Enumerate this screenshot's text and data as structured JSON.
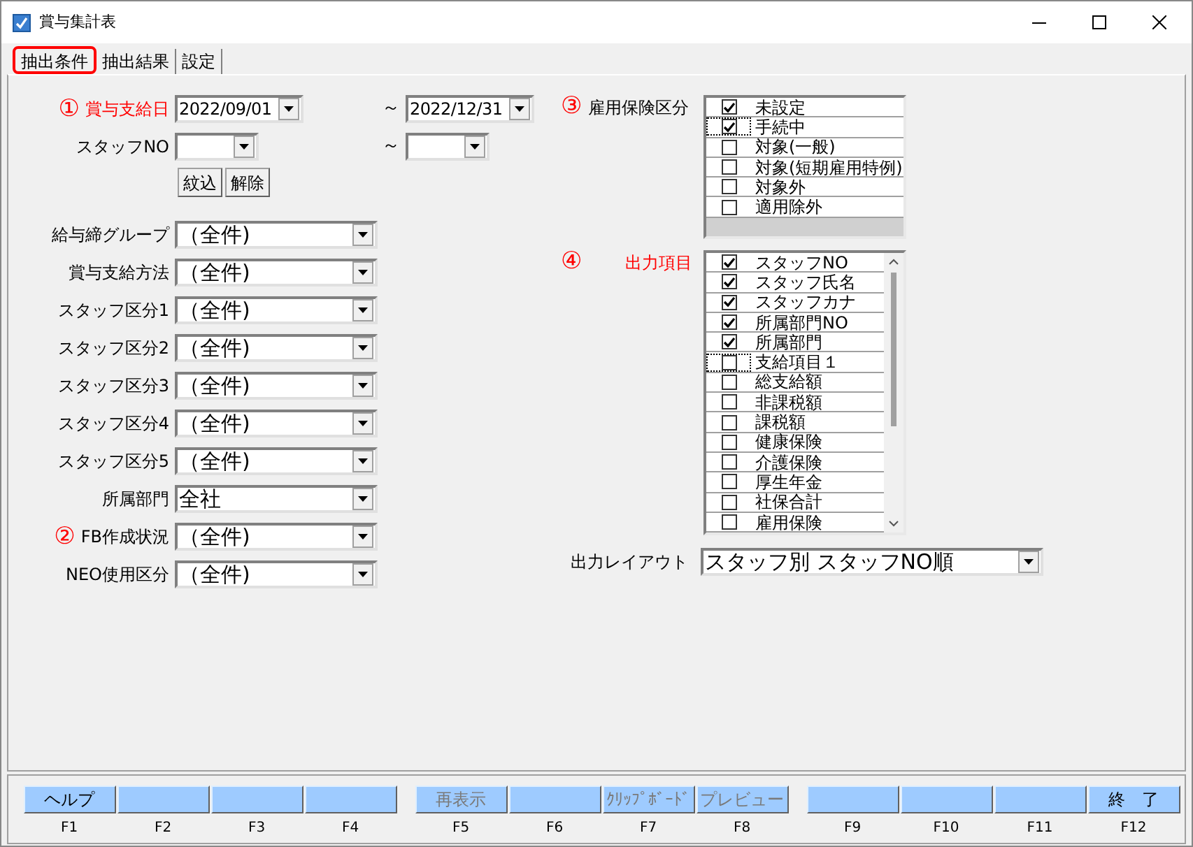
{
  "window": {
    "title": "賞与集計表"
  },
  "tabs": [
    {
      "label": "抽出条件",
      "selected": true,
      "annotated": true
    },
    {
      "label": "抽出結果",
      "selected": false,
      "annotated": false
    },
    {
      "label": "設定",
      "selected": false,
      "annotated": false
    }
  ],
  "range_fields": [
    {
      "kind": "date",
      "label": "賞与支給日",
      "marker": "①",
      "highlighted": true,
      "from": "2022/09/01",
      "separator": "～",
      "to": "2022/12/31"
    },
    {
      "kind": "code",
      "label": "スタッフNO",
      "highlighted": false,
      "separator": "～"
    }
  ],
  "filter_buttons": [
    "紋込",
    "解除"
  ],
  "select_fields": [
    {
      "label": "給与締グループ",
      "highlighted": false,
      "value": "（全件)"
    },
    {
      "label": "賞与支給方法",
      "highlighted": false,
      "value": "（全件)"
    },
    {
      "label": "スタッフ区分1",
      "highlighted": false,
      "value": "（全件)"
    },
    {
      "label": "スタッフ区分2",
      "highlighted": false,
      "value": "（全件)"
    },
    {
      "label": "スタッフ区分3",
      "highlighted": false,
      "value": "（全件)"
    },
    {
      "label": "スタッフ区分4",
      "highlighted": false,
      "value": "（全件)"
    },
    {
      "label": "スタッフ区分5",
      "highlighted": false,
      "value": "（全件)"
    },
    {
      "label": "所属部門",
      "highlighted": false,
      "value": "全社"
    },
    {
      "label": "FB作成状況",
      "marker": "②",
      "highlighted": false,
      "value": "（全件)"
    },
    {
      "label": "NEO使用区分",
      "highlighted": false,
      "value": "（全件)"
    }
  ],
  "insurance": {
    "label": "雇用保険区分",
    "marker": "③",
    "highlighted": false,
    "items": [
      {
        "label": "未設定",
        "checked": true,
        "focused": false
      },
      {
        "label": "手続中",
        "checked": true,
        "focused": true
      },
      {
        "label": "対象(一般)",
        "checked": false,
        "focused": false
      },
      {
        "label": "対象(短期雇用特例)",
        "checked": false,
        "focused": false
      },
      {
        "label": "対象外",
        "checked": false,
        "focused": false
      },
      {
        "label": "適用除外",
        "checked": false,
        "focused": false
      }
    ]
  },
  "output_items": {
    "label": "出力項目",
    "marker": "④",
    "highlighted": true,
    "items": [
      {
        "label": "スタッフNO",
        "checked": true,
        "focused": false
      },
      {
        "label": "スタッフ氏名",
        "checked": true,
        "focused": false
      },
      {
        "label": "スタッフカナ",
        "checked": true,
        "focused": false
      },
      {
        "label": "所属部門NO",
        "checked": true,
        "focused": false
      },
      {
        "label": "所属部門",
        "checked": true,
        "focused": false
      },
      {
        "label": "支給項目１",
        "checked": false,
        "focused": true
      },
      {
        "label": "総支給額",
        "checked": false,
        "focused": false
      },
      {
        "label": "非課税額",
        "checked": false,
        "focused": false
      },
      {
        "label": "課税額",
        "checked": false,
        "focused": false
      },
      {
        "label": "健康保険",
        "checked": false,
        "focused": false
      },
      {
        "label": "介護保険",
        "checked": false,
        "focused": false
      },
      {
        "label": "厚生年金",
        "checked": false,
        "focused": false
      },
      {
        "label": "社保合計",
        "checked": false,
        "focused": false
      },
      {
        "label": "雇用保険",
        "checked": false,
        "focused": false
      }
    ]
  },
  "output_layout": {
    "label": "出力レイアウト",
    "value": "スタッフ別 スタッフNO順"
  },
  "function_keys": [
    {
      "label": "ヘルプ",
      "key": "F1",
      "disabled": false
    },
    {
      "key": "F2"
    },
    {
      "key": "F3"
    },
    {
      "key": "F4"
    },
    {
      "label": "再表示",
      "key": "F5",
      "disabled": true
    },
    {
      "key": "F6"
    },
    {
      "label": "ｸﾘｯﾌﾟﾎﾞｰﾄﾞ",
      "key": "F7",
      "disabled": true
    },
    {
      "label": "プレビュー",
      "key": "F8",
      "disabled": true
    },
    {
      "key": "F9"
    },
    {
      "key": "F10"
    },
    {
      "key": "F11"
    },
    {
      "label": "終　了",
      "key": "F12",
      "disabled": false
    }
  ]
}
